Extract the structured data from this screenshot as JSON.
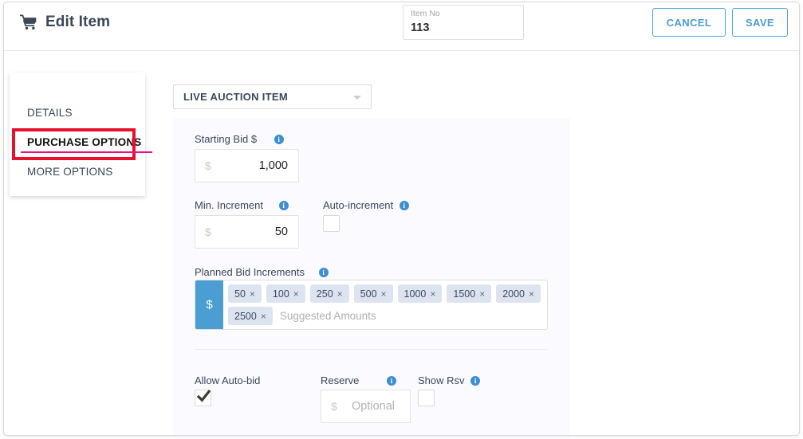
{
  "header": {
    "title": "Edit Item",
    "cart_icon": "cart-icon",
    "item_no": {
      "label": "Item No",
      "value": "113"
    },
    "cancel_label": "CANCEL",
    "save_label": "SAVE"
  },
  "sidebar": {
    "items": [
      {
        "label": "DETAILS",
        "active": false
      },
      {
        "label": "PURCHASE OPTIONS",
        "active": true
      },
      {
        "label": "MORE OPTIONS",
        "active": false
      }
    ]
  },
  "annotation": {
    "box_color": "#e8112d",
    "underline_color": "#e8127c"
  },
  "main": {
    "item_type_select": {
      "value": "LIVE AUCTION ITEM",
      "caret_icon": "chevron-down-icon"
    },
    "starting_bid": {
      "label": "Starting Bid $",
      "info_icon": "info-icon",
      "prefix": "$",
      "value": "1,000"
    },
    "min_increment": {
      "label": "Min. Increment",
      "info_icon": "info-icon",
      "prefix": "$",
      "value": "50"
    },
    "auto_increment": {
      "label": "Auto-increment",
      "info_icon": "info-icon",
      "checked": false
    },
    "planned_bid_increments": {
      "label": "Planned Bid Increments",
      "info_icon": "info-icon",
      "prefix": "$",
      "placeholder": "Suggested Amounts",
      "chips": [
        {
          "value": "50",
          "remove": "×"
        },
        {
          "value": "100",
          "remove": "×"
        },
        {
          "value": "250",
          "remove": "×"
        },
        {
          "value": "500",
          "remove": "×"
        },
        {
          "value": "1000",
          "remove": "×"
        },
        {
          "value": "1500",
          "remove": "×"
        },
        {
          "value": "2000",
          "remove": "×"
        },
        {
          "value": "2500",
          "remove": "×"
        }
      ]
    },
    "allow_auto_bid": {
      "label": "Allow Auto-bid",
      "checked": true
    },
    "reserve": {
      "label": "Reserve",
      "info_icon": "info-icon",
      "prefix": "$",
      "placeholder": "Optional",
      "value": ""
    },
    "show_rsv": {
      "label": "Show Rsv",
      "info_icon": "info-icon",
      "checked": false
    }
  },
  "colors": {
    "accent_blue": "#4a9fd6",
    "prefix_blue": "#4b9ed2",
    "chip_bg": "#dde4f0",
    "card_bg": "#fbfaff",
    "title_text": "#3c4858"
  }
}
